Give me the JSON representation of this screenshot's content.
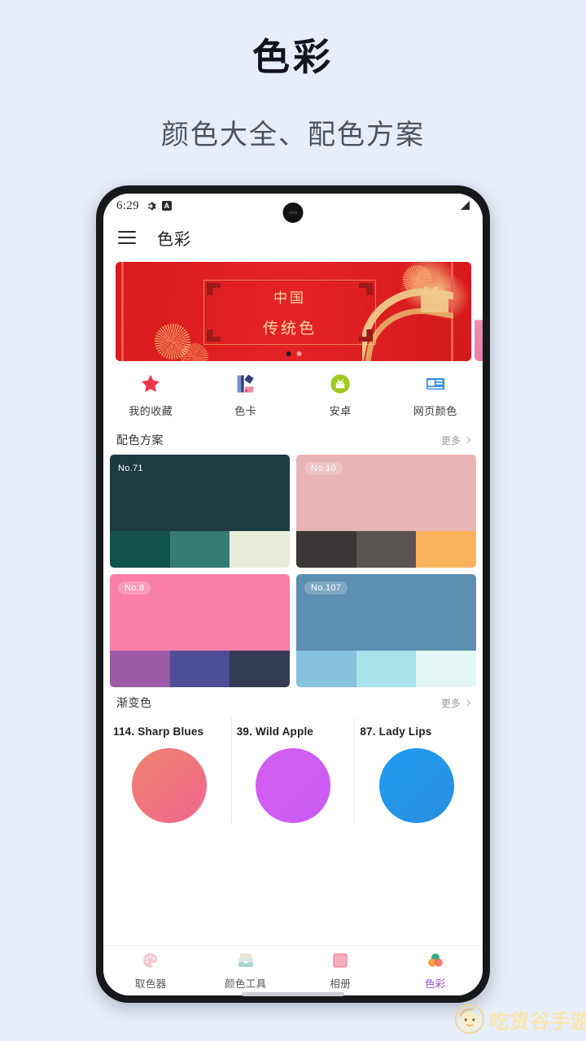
{
  "promo": {
    "title": "色彩",
    "subtitle": "颜色大全、配色方案"
  },
  "statusbar": {
    "time": "6:29",
    "gear_icon": "gear-icon",
    "a_badge": "A",
    "signal_icon": "signal-icon"
  },
  "appbar": {
    "menu_icon": "hamburger-menu-icon",
    "title": "色彩"
  },
  "banner": {
    "line1": "中国",
    "line2": "传统色",
    "dot_count": 2,
    "active_dot": 0,
    "bg_color": "#e01f20",
    "text_color": "#ffd9a8"
  },
  "quick_actions": [
    {
      "label": "我的收藏",
      "icon": "star-icon",
      "color": "#f0344a"
    },
    {
      "label": "色卡",
      "icon": "color-card-icon",
      "color": "#3b4f9e"
    },
    {
      "label": "安卓",
      "icon": "android-icon",
      "color": "#9fc920"
    },
    {
      "label": "网页颜色",
      "icon": "webpage-color-icon",
      "color": "#3b8de0"
    }
  ],
  "sections": {
    "palettes": {
      "title": "配色方案",
      "more": "更多"
    },
    "gradients": {
      "title": "渐变色",
      "more": "更多"
    }
  },
  "palettes": [
    {
      "name": "No.71",
      "main": "#1d3b40",
      "badge_style": "plain",
      "swatches": [
        "#11514f",
        "#357b74",
        "#e6ebdc"
      ]
    },
    {
      "name": "No.10",
      "main": "#e9b4b6",
      "badge_style": "pill",
      "swatches": [
        "#3b3736",
        "#595351",
        "#f9b25b"
      ]
    },
    {
      "name": "No.8",
      "main": "#fa7fa8",
      "badge_style": "pill",
      "swatches": [
        "#9c5aa5",
        "#4e4e96",
        "#333c52"
      ]
    },
    {
      "name": "No.107",
      "main": "#5b90b0",
      "badge_style": "pill",
      "swatches": [
        "#87c3dd",
        "#a8e2ea",
        "#e2f7f5"
      ]
    }
  ],
  "gradients": [
    {
      "name": "114. Sharp Blues",
      "from": "#f0826b",
      "to": "#f06790"
    },
    {
      "name": "39. Wild Apple",
      "from": "#d45ef0",
      "to": "#c85cf5"
    },
    {
      "name": "87. Lady Lips",
      "from": "#1f9bf0",
      "to": "#2b8fe0"
    }
  ],
  "bottom_nav": [
    {
      "label": "取色器",
      "icon": "palette-icon",
      "active": false
    },
    {
      "label": "颜色工具",
      "icon": "toolbox-icon",
      "active": false
    },
    {
      "label": "相册",
      "icon": "album-icon",
      "active": false
    },
    {
      "label": "色彩",
      "icon": "color-circles-icon",
      "active": true
    }
  ],
  "watermark": {
    "text": "吃货谷手游",
    "color": "#fbe49b"
  },
  "theme": {
    "page_bg": "#e7eefb",
    "phone_frame": "#17181a",
    "accent": "#9b4ec4"
  }
}
